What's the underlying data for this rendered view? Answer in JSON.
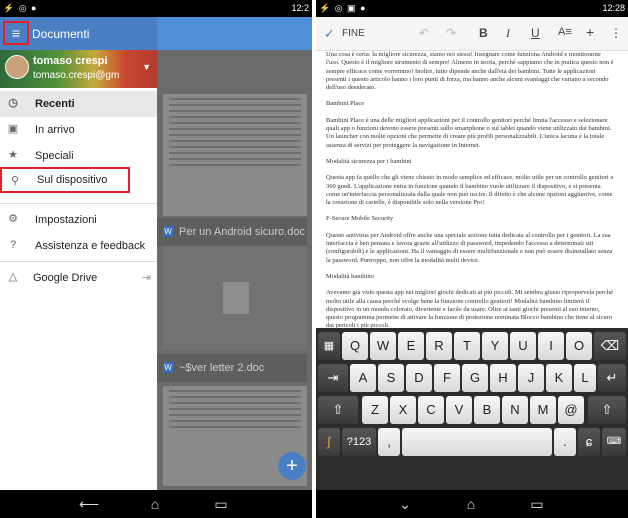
{
  "left_screen": {
    "status_time": "12:2",
    "app_title": "Documenti",
    "account": {
      "name": "tomaso crespi",
      "email": "tomaso.crespi@gm"
    },
    "drawer_items": [
      {
        "label": "Recenti",
        "icon": "clock-icon"
      },
      {
        "label": "In arrivo",
        "icon": "inbox-icon"
      },
      {
        "label": "Speciali",
        "icon": "star-icon"
      },
      {
        "label": "Sul dispositivo",
        "icon": "pin-icon"
      },
      {
        "label": "Impostazioni",
        "icon": "gear-icon"
      },
      {
        "label": "Assistenza e feedback",
        "icon": "help-icon"
      },
      {
        "label": "Google Drive",
        "icon": "drive-icon"
      }
    ],
    "docs": [
      {
        "title": "Per un Android sicuro.doc",
        "badge": "W"
      },
      {
        "title": "~$ver letter 2.doc",
        "badge": "W"
      }
    ]
  },
  "right_screen": {
    "status_time": "12:28",
    "toolbar": {
      "done_label": "FINE",
      "bold": "B",
      "italic": "I",
      "underline": "U",
      "more": "⋮"
    },
    "paragraphs": [
      "Una cosa è certa: la migliore sicurezza, siamo noi stessi! Insegnare come funziona Android e monitorarne l'uso. Questo è il migliore strumento di sempre! Almeno in teoria, perché sappiamo che in pratica questo non è sempre efficace come vorremmo! Inoltre, tutto dipende anche dall'età dei bambini. Tutte le applicazioni presenti i questo articolo hanno i loro punti di forza, ma hanno anche alcuni svantaggi che variano a secondo dell'uso desiderato.",
      "Bambini Place",
      "Bambini Place è una delle migliori applicazioni per il controllo genitori perché limita l'accesso e selezionare quali app o funzioni devono essere presenti sullo smartphone o sul tablet quando viene utilizzato dai bambini. Un launcher con molte opzioni che permette di creare più profili personalizzabili. L'unica lacuna è la totale assenza di servizi per proteggere la navigazione in Internet.",
      "Modalità sicurezza per i bambini",
      "Questa app fa quello che gli viene chiesto in modo semplice ed efficace, molto utile per un controllo genitori a 360 gradi. L'applicazione entra in funzione quando il bambino vuole utilizzare il dispositivo, e si presenta come un'interfaccia personalizzata dalla quale non può uscire. Il difetto è che alcune opzioni aggiuntive, come la creazione di cartelle, è disponibile solo nella versione Pro!",
      "F-Secure Mobile Security",
      "Questo antivirus per Android offre anche una speciale sezione tutta dedicata al controllo per i genitori. La sua interfaccia è ben pensata e lavora grazie all'utilizzo di password, impedendo l'accesso a determinati siti (configurabili) e le applicazioni. Ha il vantaggio di essere multifunzionale e non può essere disinstallato senza la password. Purtroppo, non offre la modalità multi device.",
      "Modalità bambino",
      "Avevamo già visto questa app nei migliori giochi dedicati ai più piccoli. Mi sembra giusto riproporvela perché molto utile alla causa perché svolge bene la funzione controllo genitori! Modalità bambino limiterà il dispositivo in un mondo colorato, divertente e facile da usare. Oltre ai tanti giochi presenti al suo interno, questo programma permette di attivare la funzione di protezione nominata Blocco bambino che tiene al sicuro dai pericoli i più piccoli."
    ],
    "keyboard": {
      "row1": [
        "Q",
        "W",
        "E",
        "R",
        "T",
        "Y",
        "U",
        "I",
        "O",
        "P"
      ],
      "row2": [
        "A",
        "S",
        "D",
        "F",
        "G",
        "H",
        "J",
        "K",
        "L"
      ],
      "row3": [
        "Z",
        "X",
        "C",
        "V",
        "B",
        "N",
        "M",
        "@"
      ],
      "sym_label": "?123",
      "comma": ",",
      "period": "."
    }
  }
}
